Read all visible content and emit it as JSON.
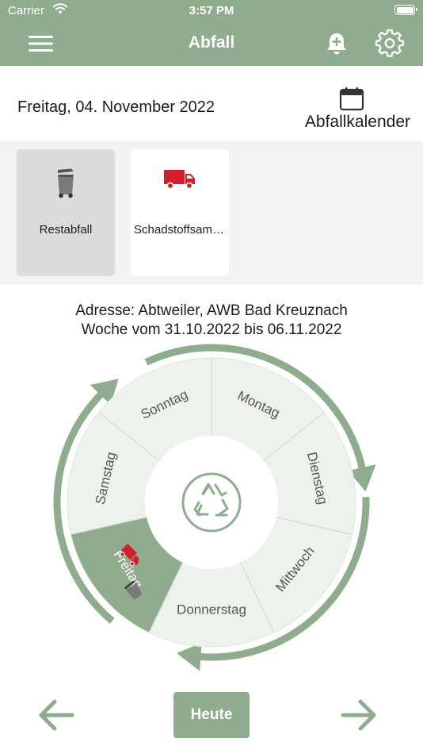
{
  "status_bar": {
    "carrier": "Carrier",
    "time": "3:57 PM"
  },
  "nav": {
    "title": "Abfall"
  },
  "header": {
    "date": "Freitag, 04. November 2022",
    "calendar_label": "Abfallkalender"
  },
  "waste_types": [
    {
      "label": "Restabfall",
      "selected": true,
      "icon": "trash-bin-icon"
    },
    {
      "label": "Schadstoffsammlung",
      "selected": false,
      "icon": "truck-icon"
    }
  ],
  "address": {
    "line1": "Adresse: Abtweiler, AWB Bad Kreuznach",
    "line2": "Woche vom 31.10.2022 bis 06.11.2022"
  },
  "wheel": {
    "days": [
      "Montag",
      "Dienstag",
      "Mittwoch",
      "Donnerstag",
      "Freitag",
      "Samstag",
      "Sonntag"
    ],
    "active_day": "Freitag",
    "center_icon": "recycle-icon"
  },
  "footer": {
    "today_label": "Heute"
  },
  "colors": {
    "accent": "#90ac8f",
    "segment": "#eef2ed",
    "truck_red": "#d0202a",
    "bin_gray": "#7a7a7a"
  }
}
